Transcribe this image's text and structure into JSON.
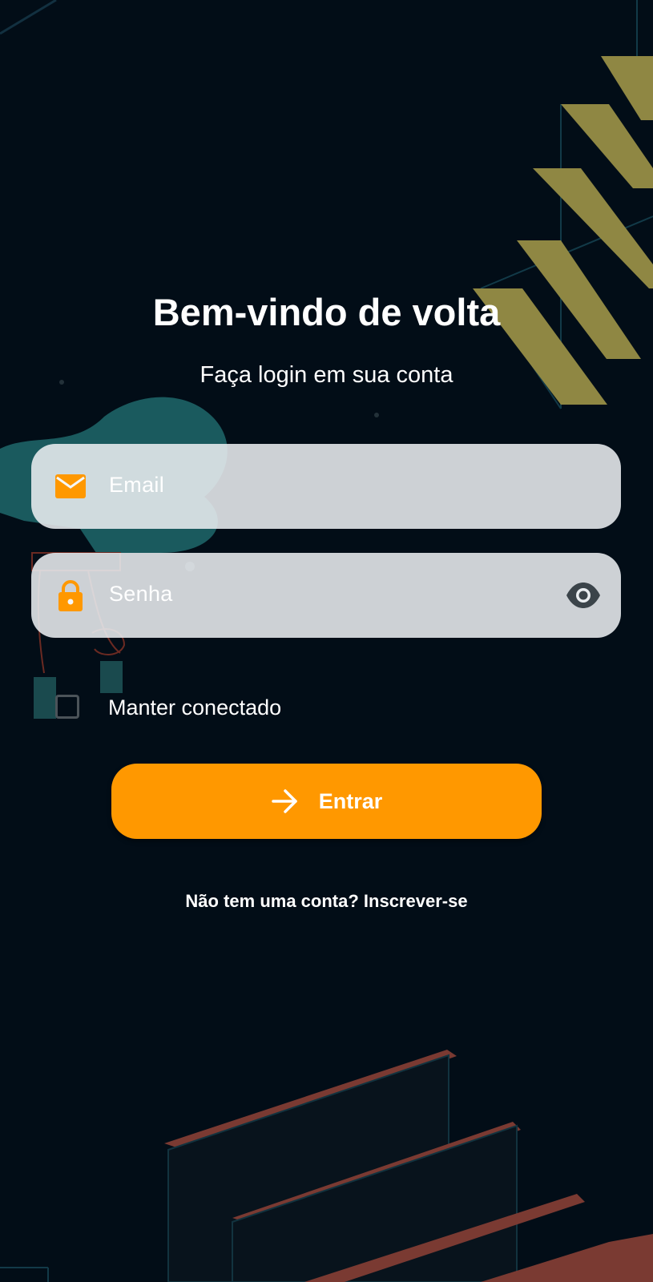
{
  "header": {
    "title": "Bem-vindo de volta",
    "subtitle": "Faça login em sua conta"
  },
  "form": {
    "email": {
      "placeholder": "Email",
      "icon": "envelope-icon"
    },
    "password": {
      "placeholder": "Senha",
      "icon": "lock-icon",
      "toggle_icon": "eye-icon"
    },
    "remember": {
      "label": "Manter conectado",
      "checked": false
    },
    "submit": {
      "label": "Entrar",
      "icon": "arrow-right-icon"
    }
  },
  "footer": {
    "signup_text": "Não tem uma conta? Inscrever-se"
  },
  "colors": {
    "accent": "#ff9800",
    "background": "#020d17",
    "field_background": "#e9edf0",
    "text": "#ffffff"
  }
}
